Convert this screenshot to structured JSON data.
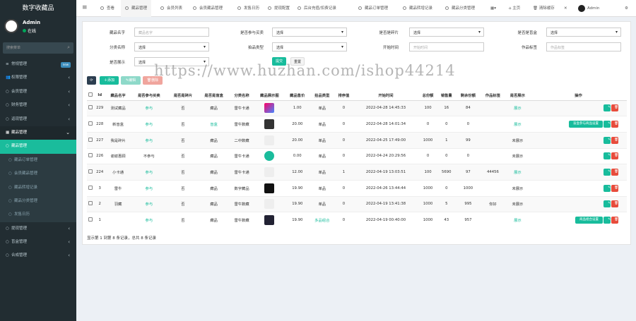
{
  "app": {
    "title": "数字收藏品"
  },
  "user": {
    "name": "Admin",
    "status": "在线"
  },
  "search": {
    "placeholder": "搜索菜单"
  },
  "menu": [
    {
      "label": "常规管理",
      "badge": "new",
      "type": "top"
    },
    {
      "label": "权限管理",
      "type": "top"
    },
    {
      "label": "会员管理",
      "type": "top"
    },
    {
      "label": "财务管理",
      "type": "top"
    },
    {
      "label": "返现管理",
      "type": "top"
    },
    {
      "label": "藏品管理",
      "type": "open"
    },
    {
      "label": "藏品管理",
      "type": "active"
    },
    {
      "label": "藏品订单管理",
      "type": "sub"
    },
    {
      "label": "会员藏品管理",
      "type": "sub"
    },
    {
      "label": "藏品转增记录",
      "type": "sub"
    },
    {
      "label": "藏品分类管理",
      "type": "sub"
    },
    {
      "label": "发售日历",
      "type": "sub"
    },
    {
      "label": "提现管理",
      "type": "top"
    },
    {
      "label": "盲盒管理",
      "type": "top"
    },
    {
      "label": "合成管理",
      "type": "top"
    }
  ],
  "tabs": [
    "查看",
    "藏品管理",
    "会员列表",
    "会员藏品管理",
    "发售日历",
    "提现配置",
    "后台充值/扣费记录",
    "藏品订单管理",
    "藏品转增记录",
    "藏品分类管理"
  ],
  "topright": {
    "home": "主页",
    "clear": "清除缓存",
    "admin": "Admin"
  },
  "filters": {
    "name_label": "藏品名字",
    "name_placeholder": "藏品名字",
    "buy_label": "是否参与买卖",
    "buy_value": "选择",
    "frag_label": "是否是碎片",
    "frag_value": "选择",
    "box_label": "是否是盲盒",
    "box_value": "选择",
    "cat_label": "分类名称",
    "cat_value": "选择",
    "type_label": "拍品类型",
    "type_value": "选择",
    "start_label": "开始时间",
    "start_placeholder": "开始时间",
    "tag_label": "作品标签",
    "tag_placeholder": "作品标签",
    "show_label": "是否展示",
    "show_value": "选择",
    "submit": "提交",
    "reset": "重置"
  },
  "toolbar": {
    "add": "添加",
    "edit": "编辑",
    "delete": "删除"
  },
  "table": {
    "headers": [
      "Id",
      "藏品名字",
      "是否参与买卖",
      "是否是碎片",
      "是否是盲盒",
      "分类名称",
      "藏品展示图",
      "藏品售价",
      "拍品类型",
      "排序值",
      "开始时间",
      "总份额",
      "销售量",
      "剩余份额",
      "作品标签",
      "是否展示",
      "操作"
    ],
    "rows": [
      {
        "id": "229",
        "name": "测试藏品",
        "buy": "参与",
        "frag": "否",
        "box": "藏品",
        "cat": "雷牛卡通",
        "price": "1.00",
        "ptype": "单品",
        "sort": "0",
        "start": "2022-04-28 14:45:33",
        "total": "100",
        "sold": "16",
        "left": "84",
        "tag": "",
        "show": "展示",
        "extra": ""
      },
      {
        "id": "228",
        "name": "新盲盒",
        "buy": "参与",
        "frag": "否",
        "box": "盲盒",
        "cat": "雷牛数藏",
        "price": "20.00",
        "ptype": "单品",
        "sort": "0",
        "start": "2022-04-28 14:01:34",
        "total": "0",
        "sold": "0",
        "left": "0",
        "tag": "",
        "show": "展示",
        "extra": "盲盒参与商品设置"
      },
      {
        "id": "227",
        "name": "我是碎片",
        "buy": "参与",
        "frag": "否",
        "box": "藏品",
        "cat": "二中数藏",
        "price": "20.00",
        "ptype": "单品",
        "sort": "0",
        "start": "2022-04-25 17:49:00",
        "total": "1000",
        "sold": "1",
        "left": "99",
        "tag": "",
        "show": "未展示",
        "extra": ""
      },
      {
        "id": "226",
        "name": "谢谢惠顾",
        "buy": "不参与",
        "frag": "否",
        "box": "藏品",
        "cat": "雷牛卡通",
        "price": "0.00",
        "ptype": "单品",
        "sort": "0",
        "start": "2022-04-24 20:29:56",
        "total": "0",
        "sold": "0",
        "left": "0",
        "tag": "",
        "show": "未展示",
        "extra": ""
      },
      {
        "id": "224",
        "name": "小卡通",
        "buy": "参与",
        "frag": "否",
        "box": "藏品",
        "cat": "雷牛卡通",
        "price": "12.00",
        "ptype": "单品",
        "sort": "1",
        "start": "2022-04-19 13:03:51",
        "total": "100",
        "sold": "5690",
        "left": "97",
        "tag": "44456",
        "show": "展示",
        "extra": ""
      },
      {
        "id": "3",
        "name": "雷牛",
        "buy": "参与",
        "frag": "否",
        "box": "藏品",
        "cat": "数字藏品",
        "price": "19.90",
        "ptype": "单品",
        "sort": "0",
        "start": "2022-04-26 13:44:44",
        "total": "1000",
        "sold": "0",
        "left": "1000",
        "tag": "",
        "show": "未展示",
        "extra": ""
      },
      {
        "id": "2",
        "name": "羽藏",
        "buy": "参与",
        "frag": "否",
        "box": "藏品",
        "cat": "雷牛数藏",
        "price": "19.90",
        "ptype": "单品",
        "sort": "0",
        "start": "2022-04-19 13:41:38",
        "total": "1000",
        "sold": "5",
        "left": "995",
        "tag": "你好",
        "show": "未展示",
        "extra": ""
      },
      {
        "id": "1",
        "name": "",
        "buy": "参与",
        "frag": "否",
        "box": "藏品",
        "cat": "雷牛数藏",
        "price": "19.90",
        "ptype": "多品组合",
        "sort": "0",
        "start": "2022-04-19 00:40:00",
        "total": "1000",
        "sold": "43",
        "left": "957",
        "tag": "",
        "show": "展示",
        "extra": "商品组合设置"
      }
    ]
  },
  "footer": {
    "text": "显示第 1 到第 8 条记录，总共 8 条记录"
  },
  "watermark": "https://www.huzhan.com/ishop44214",
  "colors": {
    "accent": "#18bc9c",
    "danger": "#e74c3c",
    "sidebar": "#222d32"
  }
}
